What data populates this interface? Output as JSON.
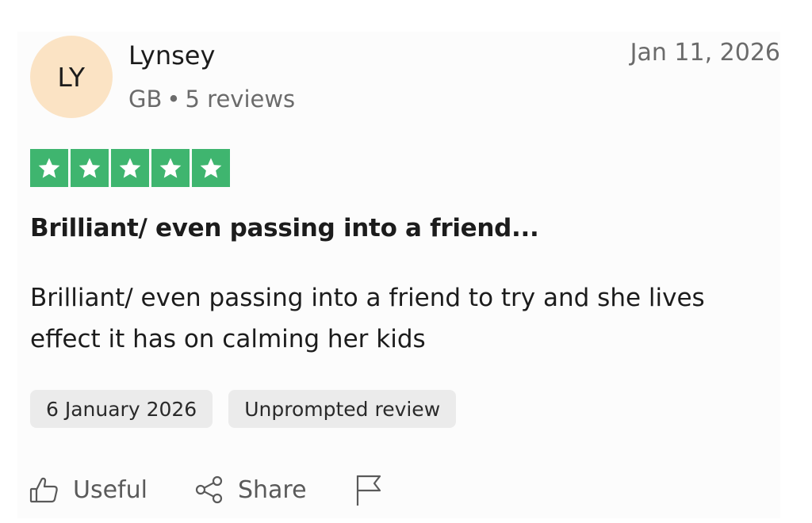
{
  "reviewer": {
    "initials": "LY",
    "name": "Lynsey",
    "country": "GB",
    "separator": "•",
    "review_count": "5 reviews"
  },
  "review": {
    "date": "Jan 11, 2026",
    "rating": 5,
    "rating_max": 5,
    "star_color": "#3fb56f",
    "title": "Brilliant/ even passing into a friend...",
    "body": "Brilliant/ even passing into a friend to try and she lives effect it has on calming her kids",
    "experience_date": "6 January 2026",
    "tag": "Unprompted review"
  },
  "actions": {
    "useful_label": "Useful",
    "share_label": "Share",
    "useful_icon": "thumbs-up-icon",
    "share_icon": "share-icon",
    "report_icon": "flag-icon"
  },
  "colors": {
    "avatar_bg": "#fbe3c4",
    "badge_bg": "#ebebeb",
    "muted_text": "#6b6b6b"
  }
}
